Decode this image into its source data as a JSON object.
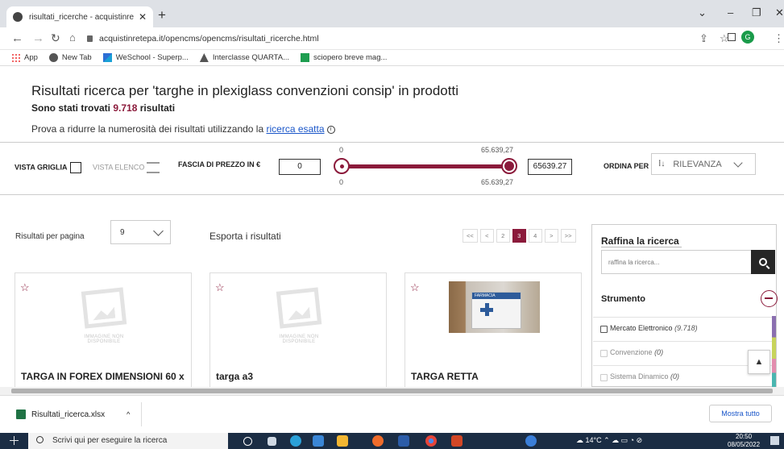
{
  "browser": {
    "tab_title": "risultati_ricerche - acquistinretep",
    "url": "acquistinretepa.it/opencms/opencms/risultati_ricerche.html",
    "profile_initial": "G",
    "bookmarks": [
      "App",
      "New Tab",
      "WeSchool - Superp...",
      "Interclasse QUARTA...",
      "sciopero breve mag..."
    ]
  },
  "page": {
    "title": "Risultati ricerca per 'targhe in plexiglass convenzioni consip' in prodotti",
    "count_prefix": "Sono stati trovati",
    "count_value": "9.718",
    "count_suffix": "risultati",
    "hint_text": "Prova a ridurre la numerosità dei risultati utilizzando la",
    "hint_link": "ricerca esatta"
  },
  "filters": {
    "grid_view": "VISTA GRIGLIA",
    "list_view": "VISTA ELENCO",
    "price_label": "FASCIA DI PREZZO IN €",
    "price_min": "0",
    "price_max": "65639.27",
    "slider_top_min": "0",
    "slider_top_max": "65.639,27",
    "slider_bottom_min": "0",
    "slider_bottom_max": "65.639,27",
    "order_label": "ORDINA PER",
    "order_value": "RILEVANZA"
  },
  "toolbar": {
    "per_page_label": "Risultati per pagina",
    "per_page_value": "9",
    "export_label": "Esporta i risultati",
    "pager": [
      "<<",
      "<",
      "2",
      "3",
      "4",
      ">",
      ">>"
    ],
    "current_page": "3"
  },
  "products": [
    {
      "title": "TARGA IN FOREX DIMENSIONI 60 x",
      "image": "IMMAGINE NON DISPONIBILE"
    },
    {
      "title": "targa a3",
      "image": "IMMAGINE NON DISPONIBILE"
    },
    {
      "title": "TARGA RETTA",
      "image_sign": "FARMACIA"
    }
  ],
  "sidebar": {
    "title": "Raffina la ricerca",
    "search_placeholder": "raffina la ricerca...",
    "section": "Strumento",
    "options": [
      {
        "label": "Mercato Elettronico",
        "count": "(9.718)"
      },
      {
        "label": "Convenzione",
        "count": "(0)"
      },
      {
        "label": "Sistema Dinamico",
        "count": "(0)"
      }
    ]
  },
  "downloads": {
    "file": "Risultati_ricerca.xlsx",
    "show_all": "Mostra tutto"
  },
  "taskbar": {
    "search_placeholder": "Scrivi qui per eseguire la ricerca",
    "weather": "14°C",
    "time": "20:50",
    "date": "08/05/2022"
  },
  "colors": {
    "accent": "#8b1a3b",
    "link": "#1a56c9"
  }
}
